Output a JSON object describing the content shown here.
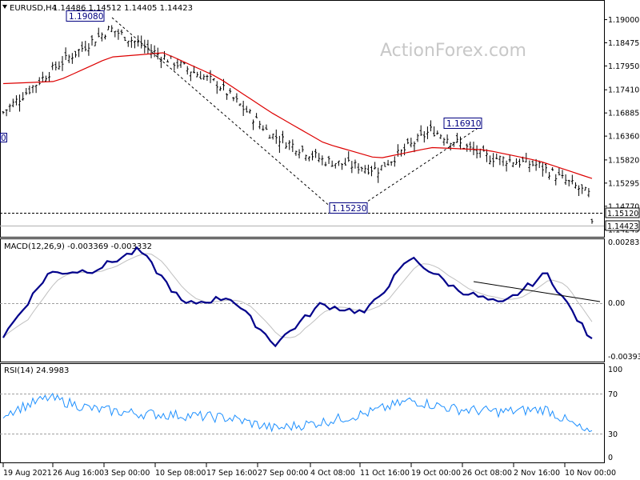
{
  "header": {
    "symbol": "EURUSD,H4",
    "ohlc": "1.14486 1.14512 1.14405 1.14423"
  },
  "watermark": "ActionForex.com",
  "price_axis": {
    "ticks": [
      "1.19000",
      "1.18475",
      "1.17950",
      "1.17410",
      "1.16885",
      "1.16360",
      "1.15820",
      "1.15295",
      "1.14770",
      "1.14245"
    ],
    "ref_line_label": "1.15120",
    "last_price_label": "1.14423"
  },
  "annotations": {
    "high_label": "1.19080",
    "mid_high_label": "1.16910",
    "low_label": "1.15230",
    "left_edge_fragment": "0"
  },
  "macd": {
    "title": "MACD(12,26,9) -0.003369 -0.003332",
    "ticks": [
      "0.00283",
      "0.00",
      "-0.003939"
    ]
  },
  "rsi": {
    "title": "RSI(14) 24.9983",
    "ticks": [
      "100",
      "70",
      "30",
      "0"
    ]
  },
  "time_axis": {
    "labels": [
      "19 Aug 2021",
      "26 Aug 16:00",
      "3 Sep 00:00",
      "10 Sep 08:00",
      "17 Sep 16:00",
      "27 Sep 00:00",
      "4 Oct 08:00",
      "11 Oct 16:00",
      "19 Oct 00:00",
      "26 Oct 08:00",
      "2 Nov 16:00",
      "10 Nov 00:00"
    ]
  },
  "colors": {
    "price_bars": "#000000",
    "moving_average": "#dd0000",
    "macd_line": "#00008b",
    "signal_line": "#c0c0c0",
    "rsi_line": "#1e90ff",
    "label_text": "#000080"
  },
  "chart_data": [
    {
      "type": "ohlc",
      "title": "EURUSD,H4",
      "x": [
        "19 Aug 2021",
        "26 Aug 16:00",
        "3 Sep 00:00",
        "10 Sep 08:00",
        "17 Sep 16:00",
        "27 Sep 00:00",
        "4 Oct 08:00",
        "11 Oct 16:00",
        "19 Oct 00:00",
        "26 Oct 08:00",
        "2 Nov 16:00",
        "10 Nov 00:00"
      ],
      "series": [
        {
          "name": "",
          "values": [
            1.169,
            1.1795,
            1.188,
            1.1815,
            1.1755,
            1.164,
            1.158,
            1.156,
            1.165,
            1.159,
            1.157,
            1.15
          ]
        }
      ],
      "moving_average": [
        1.1755,
        1.176,
        1.1815,
        1.1825,
        1.177,
        1.169,
        1.162,
        1.1585,
        1.161,
        1.1605,
        1.158,
        1.154
      ],
      "last_close": 1.14423,
      "reference_level": 1.1512,
      "annotated_levels": [
        1.1908,
        1.1691,
        1.1523
      ],
      "ylim": [
        1.1415,
        1.193
      ],
      "grid": false
    },
    {
      "type": "line",
      "title": "MACD(12,26,9) -0.003369 -0.003332",
      "series": [
        {
          "name": "",
          "values": [
            -0.003,
            0.001,
            0.0012,
            0.0025,
            -0.001,
            -0.0005,
            -0.0035,
            -0.001,
            -0.0015,
            0.002,
            0.0,
            -0.001,
            0.001,
            -0.0033
          ]
        }
      ],
      "reference_level": 0.0,
      "ylim": [
        -0.0045,
        0.003
      ]
    },
    {
      "type": "line",
      "title": "RSI(14) 24.9983",
      "series": [
        {
          "name": "",
          "values": [
            50,
            68,
            55,
            50,
            48,
            45,
            33,
            40,
            50,
            65,
            55,
            52,
            55,
            25
          ]
        }
      ],
      "levels": [
        70,
        30
      ],
      "ylim": [
        0,
        100
      ]
    }
  ]
}
